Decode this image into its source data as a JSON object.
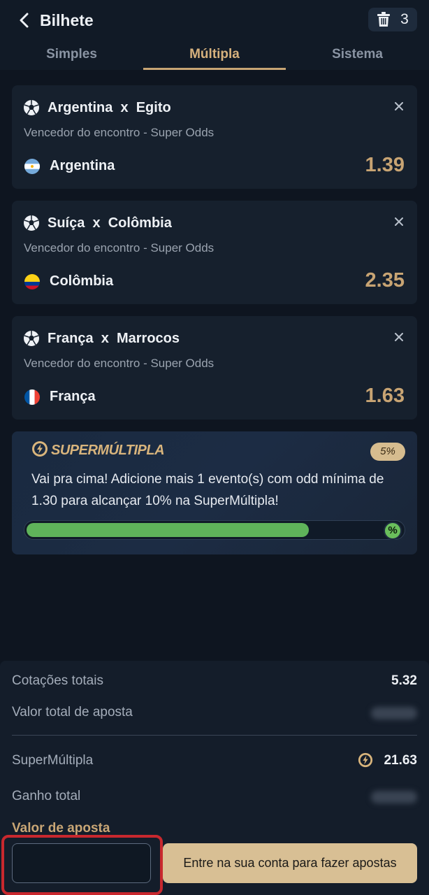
{
  "header": {
    "title": "Bilhete",
    "trash_count": "3"
  },
  "tabs": [
    {
      "label": "Simples",
      "active": false
    },
    {
      "label": "Múltipla",
      "active": true
    },
    {
      "label": "Sistema",
      "active": false
    }
  ],
  "selections": [
    {
      "home": "Argentina",
      "sep": "x",
      "away": "Egito",
      "market": "Vencedor do encontro - Super Odds",
      "pick": "Argentina",
      "odd": "1.39",
      "flag": "argentina"
    },
    {
      "home": "Suíça",
      "sep": "x",
      "away": "Colômbia",
      "market": "Vencedor do encontro - Super Odds",
      "pick": "Colômbia",
      "odd": "2.35",
      "flag": "colombia"
    },
    {
      "home": "França",
      "sep": "x",
      "away": "Marrocos",
      "market": "Vencedor do encontro - Super Odds",
      "pick": "França",
      "odd": "1.63",
      "flag": "france"
    }
  ],
  "super_multipla": {
    "title": "SUPERMÚLTIPLA",
    "badge": "5%",
    "message": "Vai pra cima! Adicione mais 1 evento(s) com odd mínima de 1.30 para alcançar 10% na SuperMúltipla!",
    "progress_fraction": 0.75,
    "end_icon": "%"
  },
  "summary": {
    "total_odds_label": "Cotações totais",
    "total_odds_value": "5.32",
    "total_stake_label": "Valor total de aposta",
    "super_label": "SuperMúltipla",
    "super_value": "21.63",
    "total_win_label": "Ganho total",
    "stake_label": "Valor de aposta"
  },
  "actions": {
    "login_button": "Entre na sua conta para fazer apostas"
  },
  "colors": {
    "accent_gold": "#c8a473",
    "progress_green": "#5fb35a",
    "background": "#0e1520",
    "highlight_red": "#c8282e"
  }
}
